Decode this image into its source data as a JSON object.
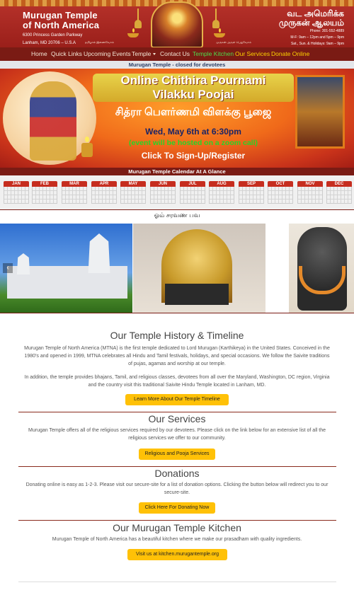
{
  "header": {
    "title_line1": "Murugan Temple",
    "title_line2": "of North America",
    "address_line1": "6300 Princess Garden Parkway",
    "address_line2": "Lanham, MD 20706 – U.S.A",
    "tamil_title_line1": "வட அமெரிக்க",
    "tamil_title_line2": "முருகன் ஆலயம்",
    "phone": "Phone: 301-552-4889",
    "hours_weekday": "M-F: 9am – 12pm and 5pm – 9pm",
    "hours_weekend": "Sat., Sun. & Holidays: 9am – 9pm",
    "tamil_small_left": "தமிழால் இணைவோம்",
    "tamil_small_right": "முருகன் அருள் பெறுவோம்"
  },
  "nav": {
    "items": [
      {
        "label": "Home"
      },
      {
        "label": "Quick Links"
      },
      {
        "label": "Upcoming Events"
      },
      {
        "label": "Temple"
      },
      {
        "label": "Contact Us"
      },
      {
        "label": "Temple Kitchen"
      },
      {
        "label": "Our Services"
      },
      {
        "label": "Donate Online"
      }
    ],
    "accent_green": "#4ddc4d",
    "accent_yellow": "#ffd400"
  },
  "notice": "Murugan Temple - closed for devotees",
  "promo": {
    "title_line1": "Online Chithira Pournami",
    "title_line2": "Vilakku Poojai",
    "tamil": "சித்ரா பௌர்ணமி விளக்கு பூஜை",
    "date": "Wed, May 6th at 6:30pm",
    "zoom_note": "(event will be hosted on a zoom call)",
    "cta": "Click To Sign-Up/Register"
  },
  "calendar": {
    "heading": "Murugan Temple Calendar At A Glance",
    "months": [
      "JAN",
      "FEB",
      "MAR",
      "APR",
      "MAY",
      "JUN",
      "JUL",
      "AUG",
      "SEP",
      "OCT",
      "NOV",
      "DEC"
    ]
  },
  "om_text": "ஓம் சரவண பவ",
  "gallery": {
    "prev_icon": "chevron-left-icon"
  },
  "history": {
    "title": "Our Temple History & Timeline",
    "p1": "Murugan Temple of North America (MTNA) is the first temple dedicated to Lord Murugan (Karthikeya) in the United States. Conceived in the 1980’s and opened in 1999, MTNA celebrates all Hindu and Tamil festivals, holidays, and special occasions. We follow the Saivite traditions of pujas, agamas and worship at our temple.",
    "p2": "In addition, the temple provides bhajans, Tamil, and religious classes, devotees from all over the Maryland, Washington, DC region, Virginia and the country visit this traditional Saivite Hindu Temple located in Lanham, MD.",
    "button": "Learn More About Our Temple Timeline"
  },
  "services": {
    "title": "Our Services",
    "p1": "Murugan Temple offers all of the religious services required by our devotees. Please click on the link below for an extensive list of all the religious services we offer to our community.",
    "button": "Religious and Pooja Services"
  },
  "donations": {
    "title": "Donations",
    "p1": "Donating online is easy as 1-2-3. Please visit our secure-site for a list of donation options. Clicking the button below will redirect you to our secure-site.",
    "button": "Click Here For Donating Now"
  },
  "kitchen": {
    "title": "Our Murugan Temple Kitchen",
    "p1": "Murugan Temple of North America has a beautiful kitchen where we make our prasadham with quality ingredients.",
    "button": "Visit us at kitchen.murugantemple.org"
  },
  "colors": {
    "header_red": "#9a1f1a",
    "nav_bg": "#7a1b14",
    "button_yellow": "#ffc107"
  }
}
